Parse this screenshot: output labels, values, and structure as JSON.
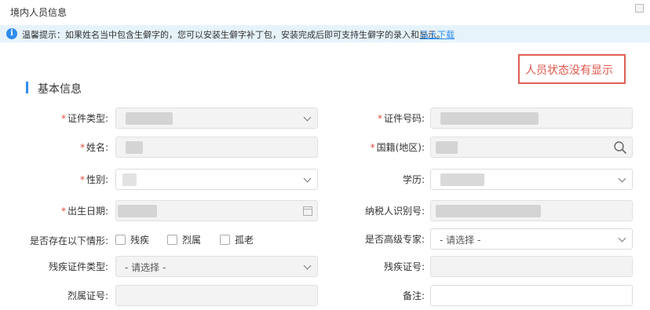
{
  "window": {
    "title": "境内人员信息"
  },
  "notice": {
    "text": "温馨提示：如果姓名当中包含生僻字的，您可以安装生僻字补丁包，安装完成后即可支持生僻字的录入和显示。",
    "link": "马上下载"
  },
  "annotation": {
    "text": "人员状态没有显示"
  },
  "section": {
    "title": "基本信息"
  },
  "required_mark": "*",
  "fields": {
    "id_type": {
      "label": "证件类型:"
    },
    "id_number": {
      "label": "证件号码:"
    },
    "name": {
      "label": "姓名:"
    },
    "nationality": {
      "label": "国籍(地区):"
    },
    "gender": {
      "label": "性别:"
    },
    "education": {
      "label": "学历:"
    },
    "birth_date": {
      "label": "出生日期:"
    },
    "taxpayer_id": {
      "label": "纳税人识别号:"
    },
    "special_status": {
      "label": "是否存在以下情形:",
      "options": [
        "残疾",
        "烈属",
        "孤老"
      ]
    },
    "senior_expert": {
      "label": "是否高级专家:",
      "value": "- 请选择 -"
    },
    "disability_cert_type": {
      "label": "残疾证件类型:",
      "value": "- 请选择 -"
    },
    "disability_cert_no": {
      "label": "残疾证号:"
    },
    "martyr_cert_no": {
      "label": "烈属证号:"
    },
    "remark": {
      "label": "备注:"
    }
  },
  "icons": {
    "info": "info-icon",
    "dropdown": "chevron-down-icon",
    "search": "search-icon",
    "calendar": "calendar-icon"
  },
  "colors": {
    "accent": "#2d8cf0",
    "notice_bg": "#e6f3fb",
    "required": "#e04c3c",
    "annotation": "#e0574b"
  }
}
